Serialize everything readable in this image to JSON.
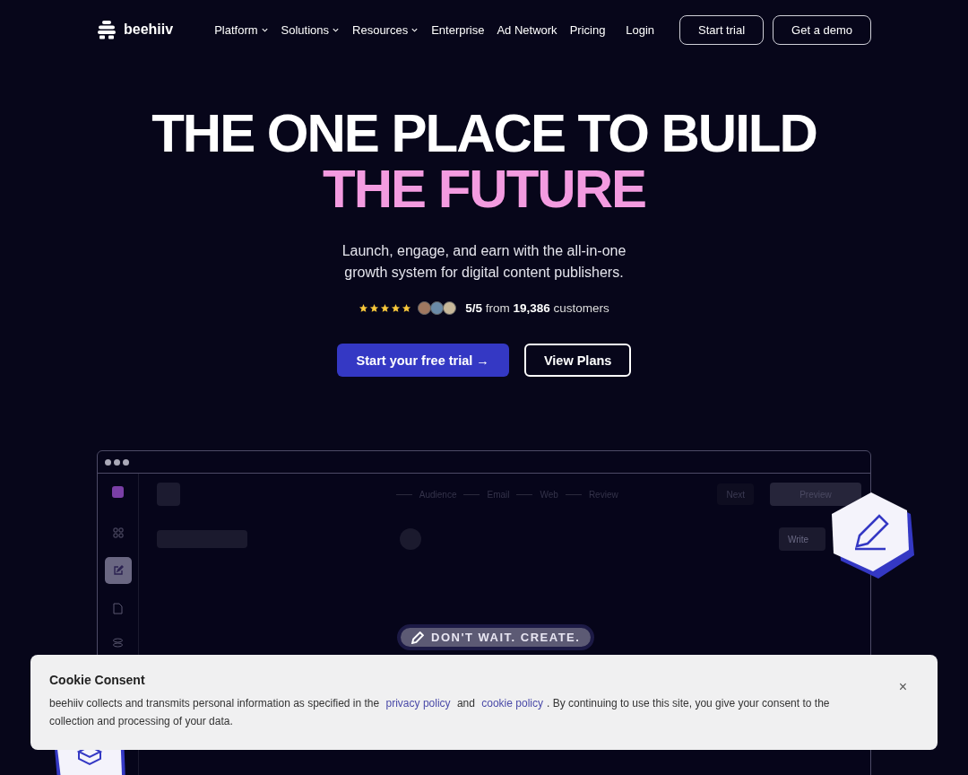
{
  "nav": {
    "brand": "beehiiv",
    "links": [
      {
        "label": "Platform",
        "dropdown": true
      },
      {
        "label": "Solutions",
        "dropdown": true
      },
      {
        "label": "Resources",
        "dropdown": true
      },
      {
        "label": "Enterprise",
        "dropdown": false
      },
      {
        "label": "Ad Network",
        "dropdown": false
      },
      {
        "label": "Pricing",
        "dropdown": false
      }
    ],
    "login": "Login",
    "buttons": [
      {
        "label": "Start trial"
      },
      {
        "label": "Get a demo"
      }
    ]
  },
  "hero": {
    "title_line1": "THE ONE PLACE TO BUILD",
    "title_line2": "THE FUTURE",
    "subtitle": "Launch, engage, and earn with the all-in-one growth system for digital content publishers.",
    "rating": {
      "stars": 5,
      "score": "5/5",
      "from": "from",
      "count": "19,386",
      "suffix": "customers"
    },
    "primary": "Start your free trial →",
    "secondary": "View Plans"
  },
  "app_preview": {
    "sidebar": [
      {
        "kind": "grid",
        "selected": false
      },
      {
        "kind": "edit",
        "selected": true
      },
      {
        "kind": "file",
        "selected": false
      },
      {
        "kind": "stack",
        "selected": false
      }
    ],
    "steps": [
      "Audience",
      "Email",
      "Web",
      "Review"
    ],
    "next": "Next",
    "preview": "Preview",
    "write": "Write",
    "tagline": "DON'T WAIT. CREATE."
  },
  "cookie": {
    "title": "Cookie Consent",
    "parts": [
      {
        "kind": "text",
        "text": "beehiiv collects and transmits personal information as specified in the "
      },
      {
        "kind": "link",
        "text": "privacy policy"
      },
      {
        "kind": "text",
        "text": " and "
      },
      {
        "kind": "link",
        "text": "cookie policy"
      },
      {
        "kind": "text",
        "text": ". By continuing to use this site, you give your consent to the collection and processing of your data."
      }
    ],
    "close": "×"
  }
}
